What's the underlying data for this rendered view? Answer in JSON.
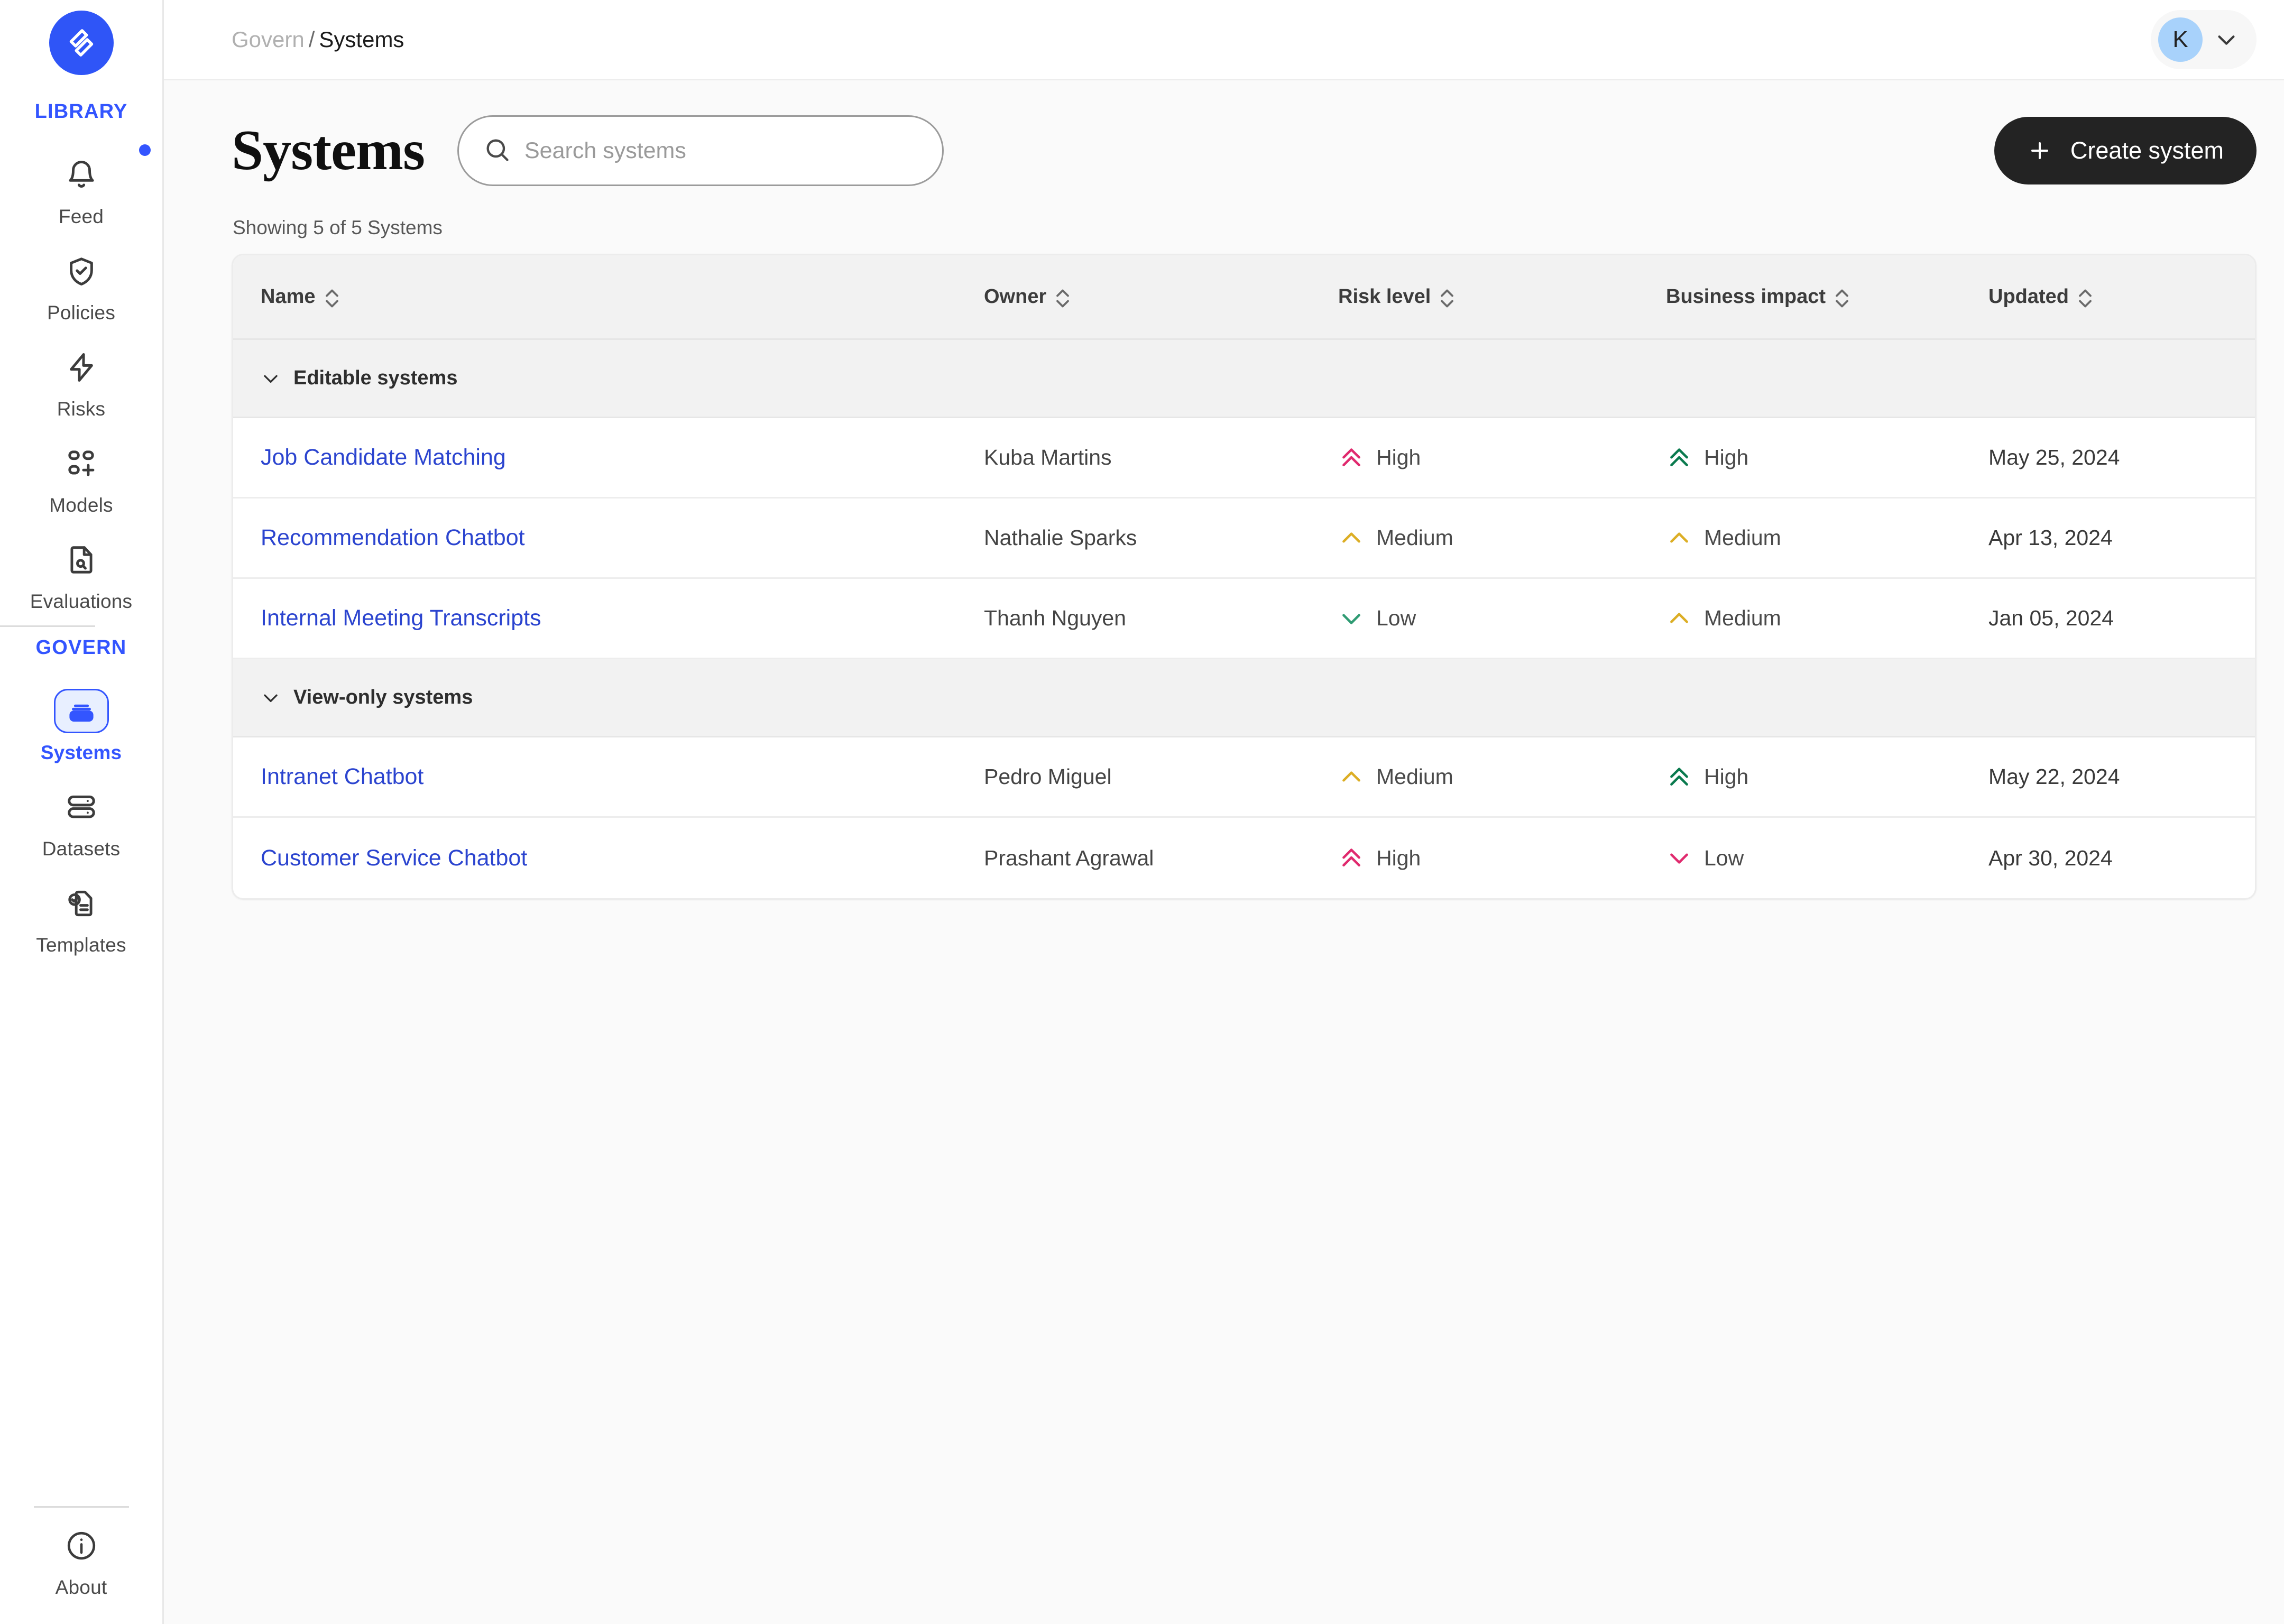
{
  "brand": {
    "logo_icon": "validmind-logo-icon",
    "accent": "#3355ff",
    "logo_bg": "#2f55f7"
  },
  "sidebar": {
    "sections": [
      {
        "label": "LIBRARY",
        "items": [
          {
            "label": "Feed",
            "icon": "bell-icon",
            "badge": true,
            "active": false
          },
          {
            "label": "Policies",
            "icon": "shield-check-icon",
            "badge": false,
            "active": false
          },
          {
            "label": "Risks",
            "icon": "lightning-bolt-icon",
            "badge": false,
            "active": false
          },
          {
            "label": "Models",
            "icon": "grid-plus-icon",
            "badge": false,
            "active": false
          },
          {
            "label": "Evaluations",
            "icon": "document-search-icon",
            "badge": false,
            "active": false
          }
        ]
      },
      {
        "label": "GOVERN",
        "items": [
          {
            "label": "Systems",
            "icon": "stack-box-icon",
            "badge": false,
            "active": true
          },
          {
            "label": "Datasets",
            "icon": "database-stack-icon",
            "badge": false,
            "active": false
          },
          {
            "label": "Templates",
            "icon": "document-check-icon",
            "badge": false,
            "active": false
          }
        ]
      }
    ],
    "bottom": {
      "label": "About",
      "icon": "info-circle-icon"
    }
  },
  "topbar": {
    "breadcrumb": {
      "parent": "Govern",
      "separator": "/",
      "current": "Systems"
    },
    "user": {
      "initial": "K",
      "chevron_icon": "chevron-down-icon",
      "avatar_color": "#a8d2fb"
    }
  },
  "page": {
    "title": "Systems",
    "search": {
      "placeholder": "Search systems",
      "value": "",
      "icon": "search-icon"
    },
    "create_button": {
      "label": "Create system",
      "icon": "plus-icon"
    },
    "showing": "Showing 5 of 5 Systems"
  },
  "table": {
    "columns": [
      {
        "label": "Name",
        "sortable": true
      },
      {
        "label": "Owner",
        "sortable": true
      },
      {
        "label": "Risk level",
        "sortable": true
      },
      {
        "label": "Business impact",
        "sortable": true
      },
      {
        "label": "Updated",
        "sortable": true
      }
    ],
    "level_colors": {
      "risk_high": "#e02a6e",
      "risk_medium": "#dcae25",
      "risk_low": "#2f9b73",
      "impact_high": "#0a7a4e",
      "impact_medium": "#dcae25",
      "impact_low": "#e02a6e"
    },
    "groups": [
      {
        "label": "Editable systems",
        "caret_icon": "chevron-down-icon",
        "rows": [
          {
            "name": "Job Candidate Matching",
            "owner": "Kuba Martins",
            "risk": {
              "label": "High",
              "icon": "double-chevron-up-icon",
              "color": "#e02a6e"
            },
            "impact": {
              "label": "High",
              "icon": "double-chevron-up-icon",
              "color": "#0a7a4e"
            },
            "updated": "May 25, 2024"
          },
          {
            "name": "Recommendation Chatbot",
            "owner": "Nathalie Sparks",
            "risk": {
              "label": "Medium",
              "icon": "chevron-up-icon",
              "color": "#dcae25"
            },
            "impact": {
              "label": "Medium",
              "icon": "chevron-up-icon",
              "color": "#dcae25"
            },
            "updated": "Apr 13, 2024"
          },
          {
            "name": "Internal Meeting Transcripts",
            "owner": "Thanh Nguyen",
            "risk": {
              "label": "Low",
              "icon": "chevron-down-icon",
              "color": "#2f9b73"
            },
            "impact": {
              "label": "Medium",
              "icon": "chevron-up-icon",
              "color": "#dcae25"
            },
            "updated": "Jan 05, 2024"
          }
        ]
      },
      {
        "label": "View-only systems",
        "caret_icon": "chevron-down-icon",
        "rows": [
          {
            "name": "Intranet Chatbot",
            "owner": "Pedro Miguel",
            "risk": {
              "label": "Medium",
              "icon": "chevron-up-icon",
              "color": "#dcae25"
            },
            "impact": {
              "label": "High",
              "icon": "double-chevron-up-icon",
              "color": "#0a7a4e"
            },
            "updated": "May 22, 2024"
          },
          {
            "name": "Customer Service Chatbot",
            "owner": "Prashant Agrawal",
            "risk": {
              "label": "High",
              "icon": "double-chevron-up-icon",
              "color": "#e02a6e"
            },
            "impact": {
              "label": "Low",
              "icon": "chevron-down-icon",
              "color": "#e02a6e"
            },
            "updated": "Apr 30, 2024"
          }
        ]
      }
    ]
  }
}
